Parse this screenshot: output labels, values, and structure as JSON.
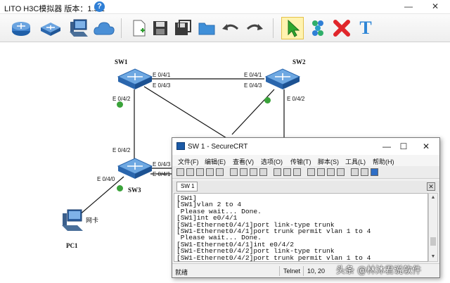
{
  "app": {
    "title": "LITO H3C模拟器 版本：1.5.2",
    "help_icon": "?",
    "window_controls": {
      "minimize": "—",
      "close": "✕"
    }
  },
  "toolbar": {
    "icons": [
      "router-icon",
      "switch-icon",
      "pc-icon",
      "cloud-icon",
      "new-file-icon",
      "save-icon",
      "save-as-icon",
      "open-folder-icon",
      "undo-icon",
      "redo-icon",
      "pointer-icon",
      "link-icon",
      "delete-icon",
      "text-icon"
    ],
    "text_tool_label": "T",
    "delete_tool_label": "✖"
  },
  "topology": {
    "devices": [
      {
        "id": "sw1",
        "label": "SW1"
      },
      {
        "id": "sw2",
        "label": "SW2"
      },
      {
        "id": "sw3",
        "label": "SW3"
      },
      {
        "id": "pc1",
        "label": "PC1"
      }
    ],
    "port_labels": {
      "sw1_e041": "E 0/4/1",
      "sw1_e043": "E 0/4/3",
      "sw1_e042": "E 0/4/2",
      "sw2_e041": "E 0/4/1",
      "sw2_e043": "E 0/4/3",
      "sw2_e042": "E 0/4/2",
      "sw3_e042": "E 0/4/2",
      "sw3_e040": "E 0/4/0",
      "sw3_e043": "E 0/4/3",
      "sw3_e041": "E 0/4/1"
    },
    "pc_nic_label": "网卡"
  },
  "securecrt": {
    "title": "SW 1 - SecureCRT",
    "window_controls": {
      "minimize": "—",
      "maximize": "☐",
      "close": "✕"
    },
    "menu": [
      "文件(F)",
      "编辑(E)",
      "查看(V)",
      "选项(O)",
      "传输(T)",
      "脚本(S)",
      "工具(L)",
      "帮助(H)"
    ],
    "tab_label": "SW 1",
    "tab_close": "✕",
    "terminal_lines": [
      "[SW1]",
      "[SW1]vlan 2 to 4",
      " Please wait... Done.",
      "[SW1]int e0/4/1",
      "[SW1-Ethernet0/4/1]port link-type trunk",
      "[SW1-Ethernet0/4/1]port trunk permit vlan 1 to 4",
      " Please wait... Done.",
      "[SW1-Ethernet0/4/1]int e0/4/2",
      "[SW1-Ethernet0/4/2]port link-type trunk",
      "[SW1-Ethernet0/4/2]port trunk permit vlan 1 to 4"
    ],
    "status": {
      "ready": "就绪",
      "protocol": "Telnet",
      "position": "10, 20"
    }
  },
  "watermark": "头条 @林沐君说软件",
  "colors": {
    "link_green": "#3aa33a",
    "switch_blue": "#3a78c4",
    "annotation_red": "#d43b3b"
  }
}
